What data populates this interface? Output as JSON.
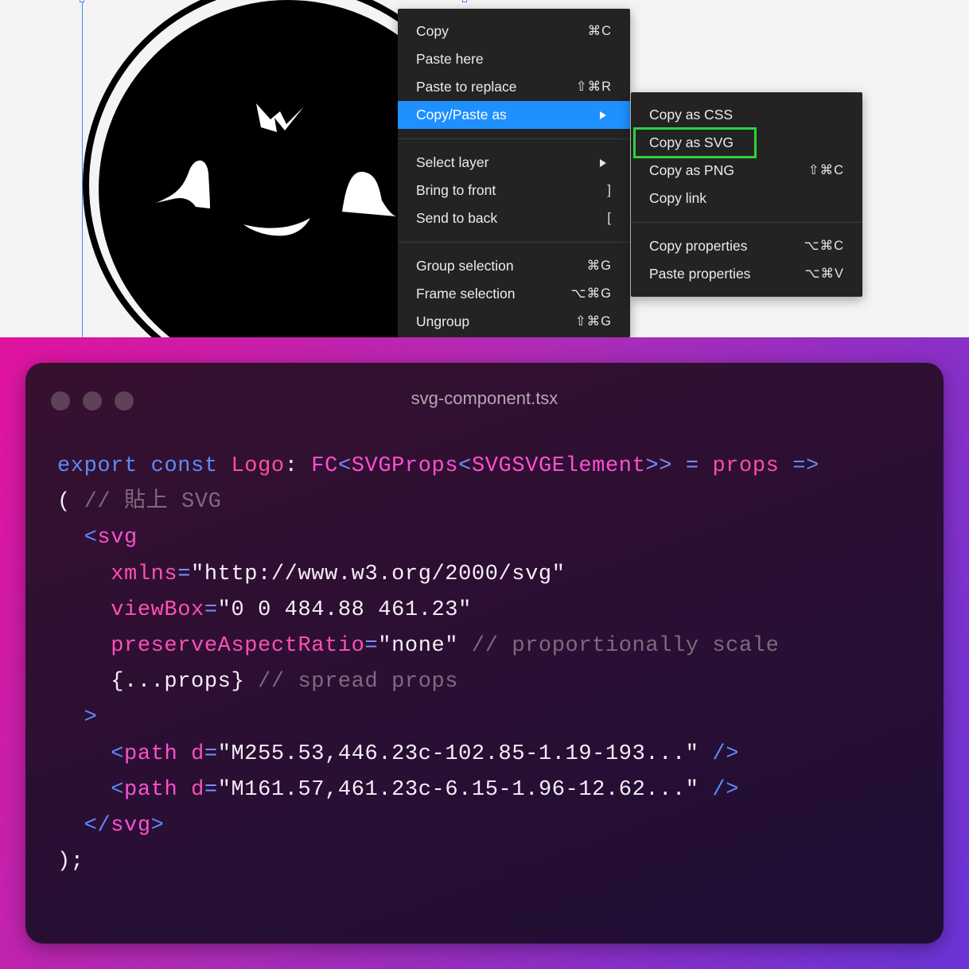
{
  "context_menu": {
    "items": [
      {
        "label": "Copy",
        "shortcut": "⌘C"
      },
      {
        "label": "Paste here",
        "shortcut": ""
      },
      {
        "label": "Paste to replace",
        "shortcut": "⇧⌘R"
      },
      {
        "label": "Copy/Paste as",
        "shortcut": "",
        "submenu": true,
        "active": true
      },
      {
        "label": "Select layer",
        "shortcut": "",
        "submenu": true
      },
      {
        "label": "Bring to front",
        "shortcut": "]"
      },
      {
        "label": "Send to back",
        "shortcut": "["
      },
      {
        "label": "Group selection",
        "shortcut": "⌘G"
      },
      {
        "label": "Frame selection",
        "shortcut": "⌥⌘G"
      },
      {
        "label": "Ungroup",
        "shortcut": "⇧⌘G"
      }
    ]
  },
  "submenu": {
    "items": [
      {
        "label": "Copy as CSS",
        "shortcut": ""
      },
      {
        "label": "Copy as SVG",
        "shortcut": "",
        "highlighted": true
      },
      {
        "label": "Copy as PNG",
        "shortcut": "⇧⌘C"
      },
      {
        "label": "Copy link",
        "shortcut": ""
      },
      {
        "label": "Copy properties",
        "shortcut": "⌥⌘C"
      },
      {
        "label": "Paste properties",
        "shortcut": "⌥⌘V"
      }
    ]
  },
  "colors": {
    "menu_bg": "#232323",
    "menu_active": "#1e90ff",
    "highlight_box": "#2fd13a",
    "guide": "#3a8df5"
  },
  "code_window": {
    "title": "svg-component.tsx",
    "lines": [
      [
        [
          "kw",
          "export"
        ],
        [
          "pl",
          " "
        ],
        [
          "kw",
          "const"
        ],
        [
          "pl",
          " "
        ],
        [
          "id",
          "Logo"
        ],
        [
          "pl",
          ": "
        ],
        [
          "ty",
          "FC"
        ],
        [
          "pn",
          "<"
        ],
        [
          "ty",
          "SVGProps"
        ],
        [
          "pn",
          "<"
        ],
        [
          "ty",
          "SVGSVGElement"
        ],
        [
          "pn",
          ">>"
        ],
        [
          "pl",
          " "
        ],
        [
          "pn",
          "="
        ],
        [
          "pl",
          " "
        ],
        [
          "id",
          "props"
        ],
        [
          "pl",
          " "
        ],
        [
          "kw",
          "=>"
        ]
      ],
      [
        [
          "pl",
          "( "
        ],
        [
          "cm",
          "// 貼上 SVG"
        ]
      ],
      [
        [
          "pl",
          "  "
        ],
        [
          "tg",
          "<"
        ],
        [
          "ty",
          "svg"
        ]
      ],
      [
        [
          "pl",
          "    "
        ],
        [
          "at",
          "xmlns"
        ],
        [
          "pn",
          "="
        ],
        [
          "st",
          "\"http://www.w3.org/2000/svg\""
        ]
      ],
      [
        [
          "pl",
          "    "
        ],
        [
          "at",
          "viewBox"
        ],
        [
          "pn",
          "="
        ],
        [
          "st",
          "\"0 0 484.88 461.23\""
        ]
      ],
      [
        [
          "pl",
          "    "
        ],
        [
          "at",
          "preserveAspectRatio"
        ],
        [
          "pn",
          "="
        ],
        [
          "st",
          "\"none\""
        ],
        [
          "pl",
          " "
        ],
        [
          "cm",
          "// proportionally scale"
        ]
      ],
      [
        [
          "pl",
          "    "
        ],
        [
          "st",
          "{...props}"
        ],
        [
          "pl",
          " "
        ],
        [
          "cm",
          "// spread props"
        ]
      ],
      [
        [
          "pl",
          "  "
        ],
        [
          "tg",
          ">"
        ]
      ],
      [
        [
          "pl",
          "    "
        ],
        [
          "tg",
          "<"
        ],
        [
          "ty",
          "path"
        ],
        [
          "pl",
          " "
        ],
        [
          "at",
          "d"
        ],
        [
          "pn",
          "="
        ],
        [
          "st",
          "\"M255.53,446.23c-102.85-1.19-193...\""
        ],
        [
          "pl",
          " "
        ],
        [
          "tg",
          "/>"
        ]
      ],
      [
        [
          "pl",
          "    "
        ],
        [
          "tg",
          "<"
        ],
        [
          "ty",
          "path"
        ],
        [
          "pl",
          " "
        ],
        [
          "at",
          "d"
        ],
        [
          "pn",
          "="
        ],
        [
          "st",
          "\"M161.57,461.23c-6.15-1.96-12.62...\""
        ],
        [
          "pl",
          " "
        ],
        [
          "tg",
          "/>"
        ]
      ],
      [
        [
          "pl",
          "  "
        ],
        [
          "tg",
          "</"
        ],
        [
          "ty",
          "svg"
        ],
        [
          "tg",
          ">"
        ]
      ],
      [
        [
          "pl",
          ");"
        ]
      ]
    ]
  }
}
